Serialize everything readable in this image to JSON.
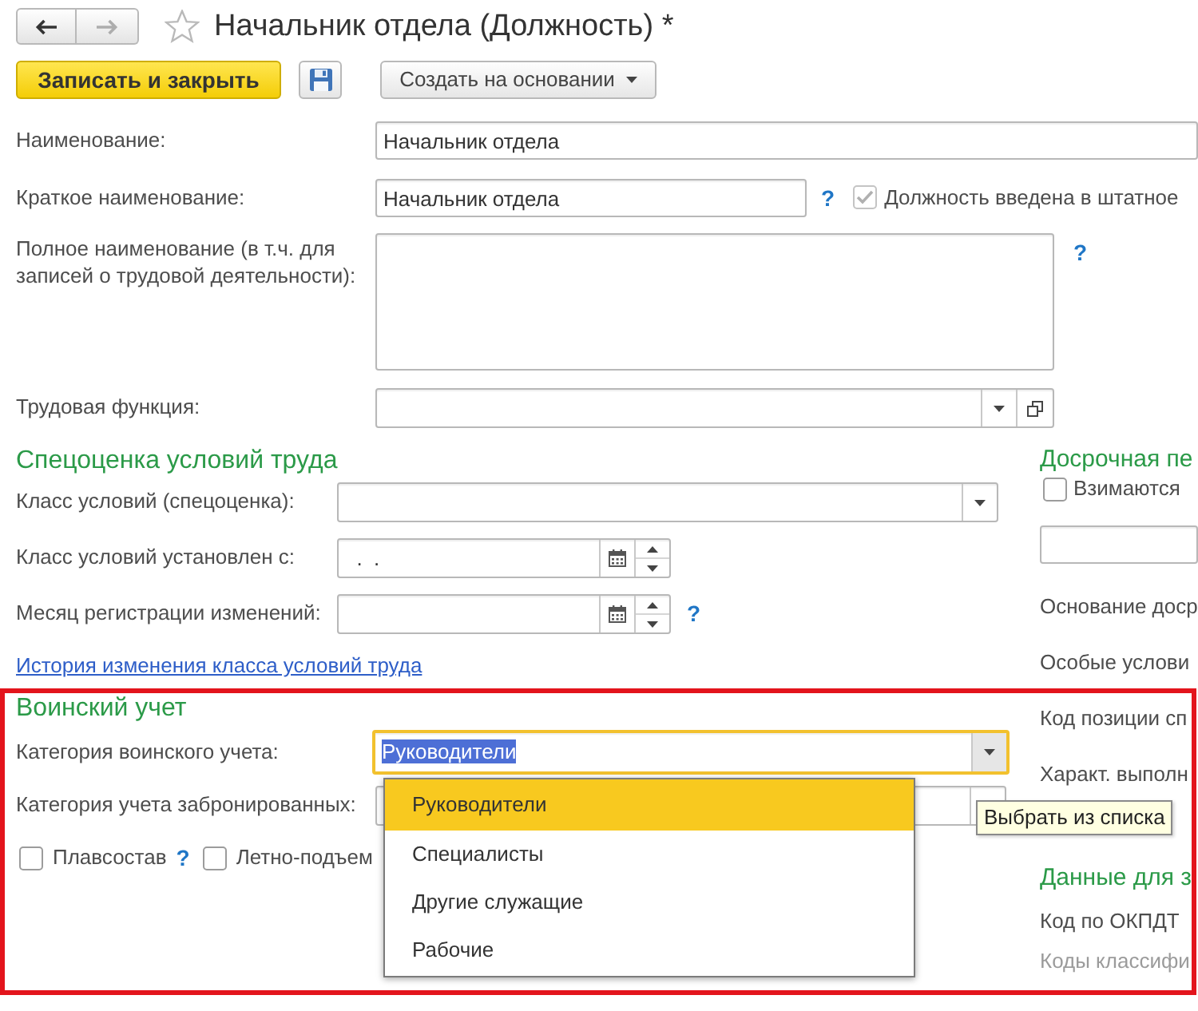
{
  "header": {
    "back_disabled": false,
    "forward_disabled": true,
    "favorite": false,
    "title": "Начальник отдела (Должность) *"
  },
  "toolbar": [
    {
      "kind": "primary",
      "label": "Записать и закрыть"
    },
    {
      "kind": "icon"
    },
    {
      "kind": "menu",
      "label": "Создать на основании"
    }
  ],
  "fields_top": [
    {
      "kind": "text",
      "label": "Наименование:",
      "value": "Начальник отдела"
    },
    {
      "kind": "text",
      "label": "Краткое наименование:",
      "value": "Начальник отдела",
      "help": "?",
      "checkbox": {
        "label": "Должность введена в штатное",
        "checked": true,
        "disabled": true
      }
    },
    {
      "kind": "multiline",
      "label": "Полное наименование (в т.ч. для записей о трудовой деятельности):",
      "help": "?"
    },
    {
      "kind": "choice_open",
      "label": "Трудовая функция:"
    }
  ],
  "sections_left": [
    {
      "heading": "Спецоценка условий труда",
      "fields": [
        {
          "kind": "choice",
          "label": "Класс условий (спецоценка):"
        },
        {
          "kind": "date",
          "label": "Класс условий установлен с:",
          "value": "  .  ."
        },
        {
          "kind": "date",
          "label": "Месяц регистрации изменений:",
          "help": "?"
        }
      ],
      "link": "История изменения класса условий труда"
    },
    {
      "heading": "Воинский учет",
      "fields": [
        {
          "kind": "choice",
          "label": "Категория воинского учета:",
          "value": "Руководители",
          "focused": true
        },
        {
          "kind": "choice",
          "label": "Категория учета забронированных:",
          "focused": false
        }
      ],
      "checkboxes": [
        {
          "label": "Плавсостав",
          "checked": false,
          "help": "?"
        },
        {
          "label": "Летно-подъем",
          "checked": false
        }
      ]
    }
  ],
  "right_sections": [
    {
      "heading": "Досрочная пе",
      "items": [
        {
          "kind": "checkbox",
          "label": "Взимаются",
          "checked": false
        },
        {
          "kind": "input"
        },
        {
          "kind": "label",
          "label": "Основание доср",
          "disabled": false
        },
        {
          "kind": "label",
          "label": "Особые услови",
          "disabled": false
        },
        {
          "kind": "label",
          "label": "Код позиции сп",
          "disabled": false
        },
        {
          "kind": "label",
          "label": "Характ. выполн",
          "disabled": false
        }
      ]
    },
    {
      "heading": "Данные для з",
      "items": [
        {
          "kind": "label",
          "label": "Код по ОКПДТ",
          "disabled": false
        },
        {
          "kind": "label",
          "label": "Коды классифи",
          "disabled": true
        }
      ]
    }
  ],
  "dropdown_list": {
    "items": [
      {
        "label": "Руководители",
        "selected": true
      },
      {
        "label": "Специалисты",
        "selected": false
      },
      {
        "label": "Другие служащие",
        "selected": false
      },
      {
        "label": "Рабочие",
        "selected": false
      }
    ]
  },
  "tooltip": "Выбрать из списка",
  "highlight_frame": true
}
